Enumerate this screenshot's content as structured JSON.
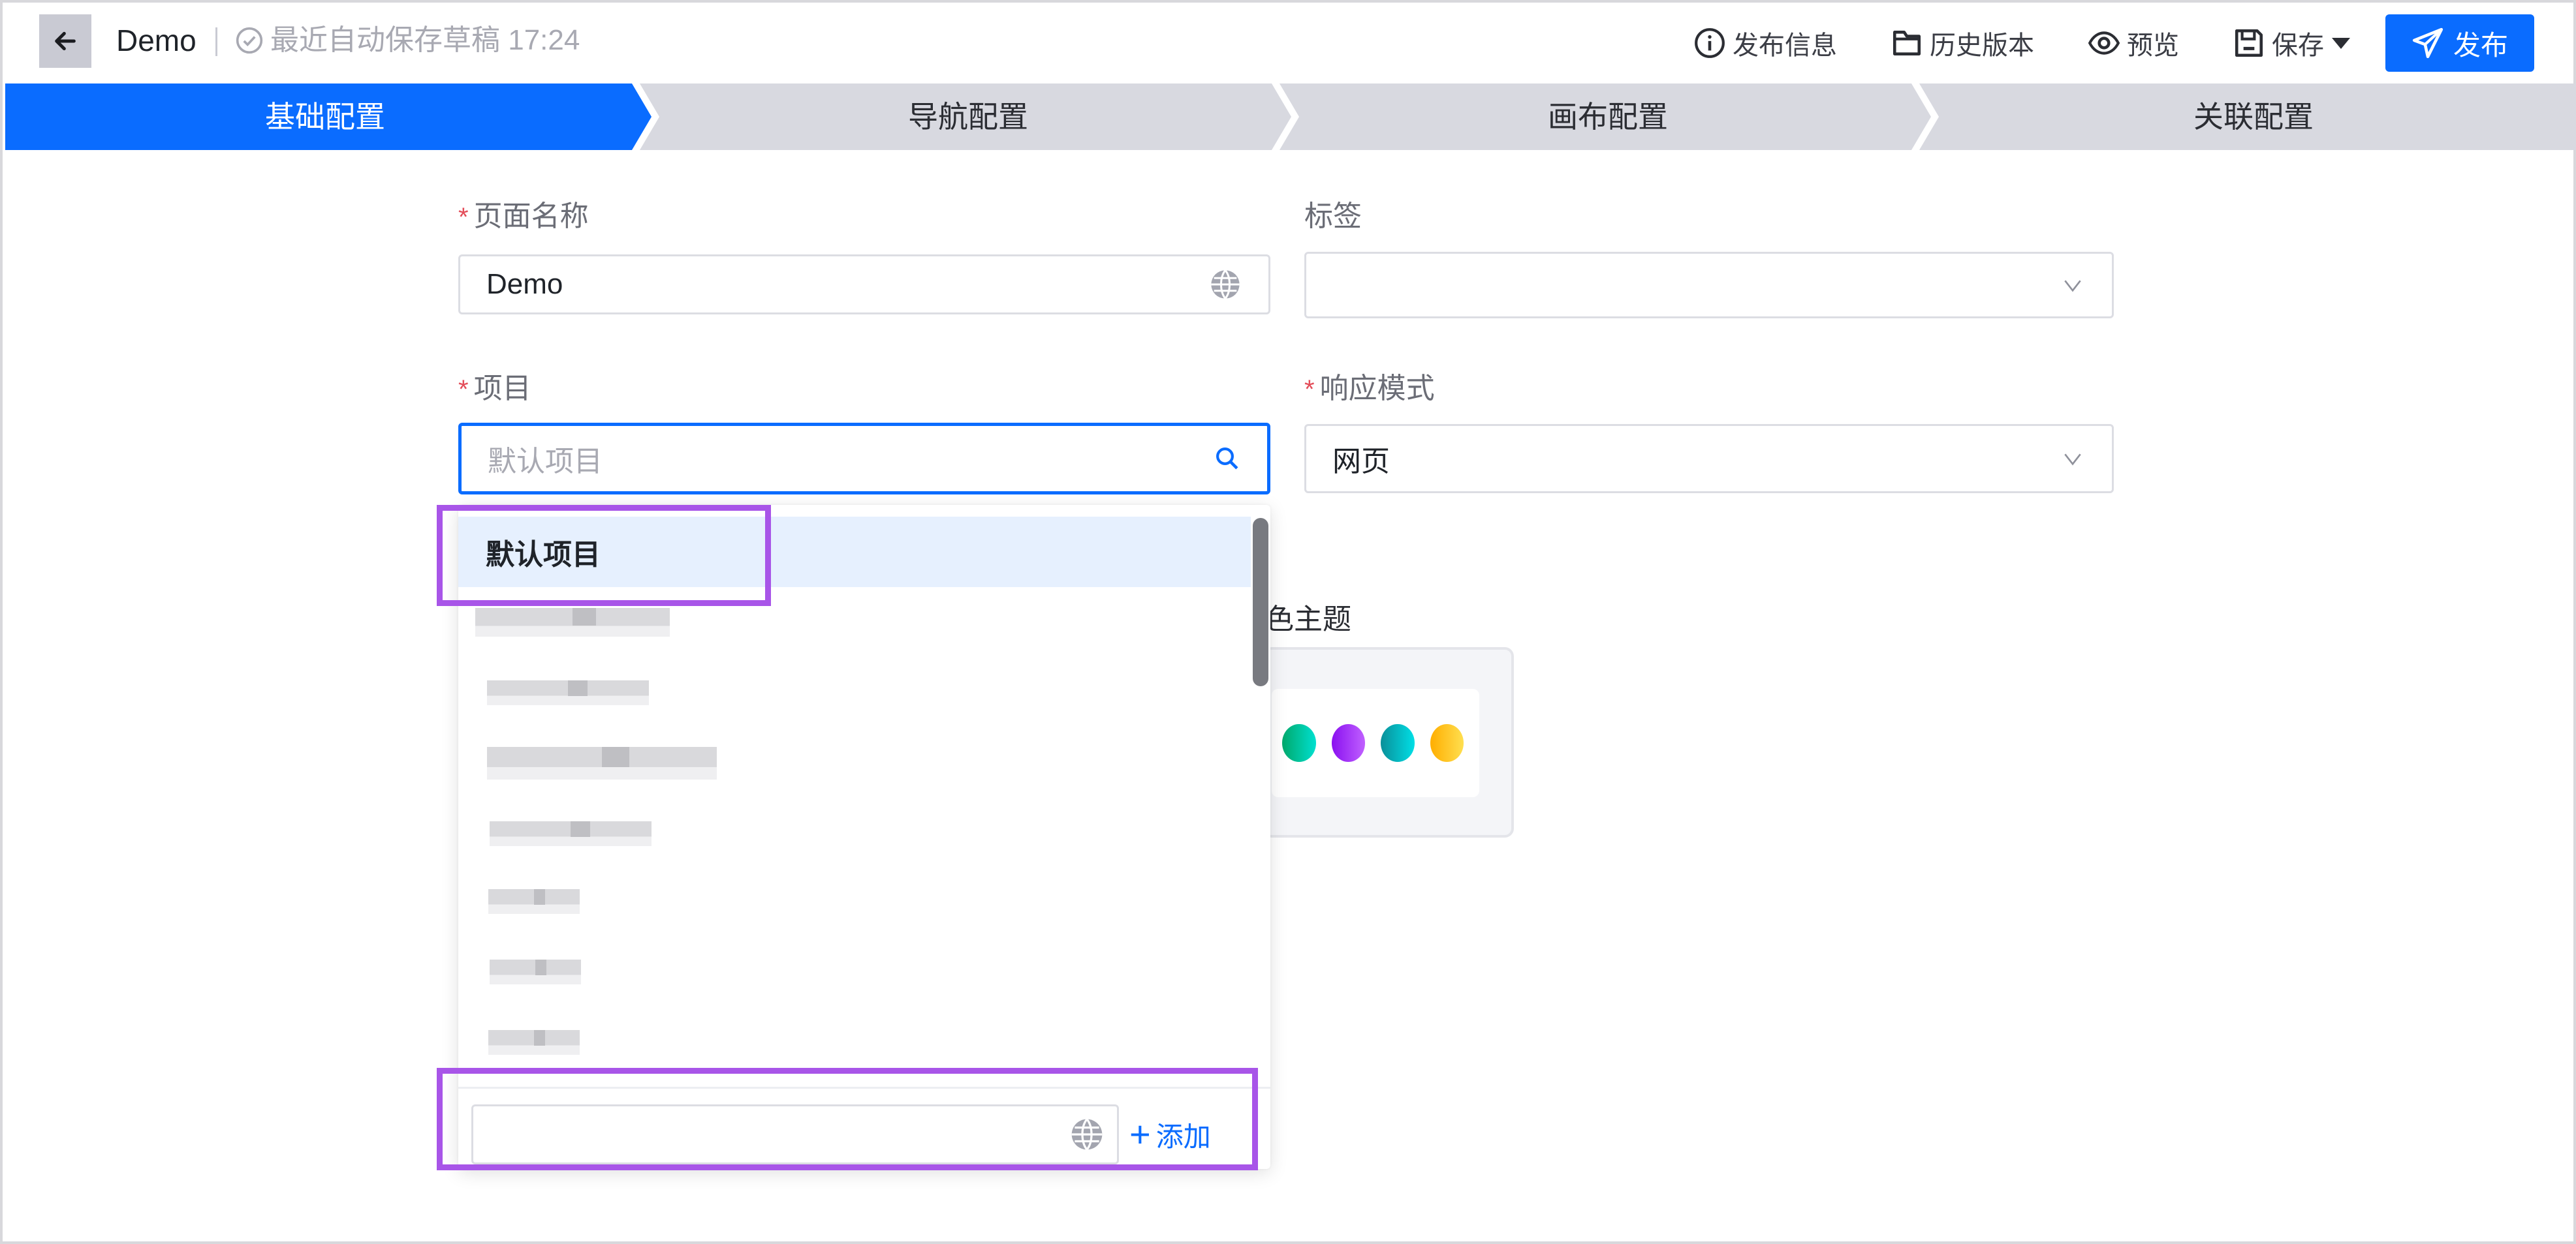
{
  "header": {
    "back_icon": "arrow-left-icon",
    "title": "Demo",
    "autosave_icon": "check-circle-icon",
    "autosave_text": "最近自动保存草稿 17:24",
    "actions": [
      {
        "icon": "info-circle-icon",
        "label": "发布信息"
      },
      {
        "icon": "folder-icon",
        "label": "历史版本"
      },
      {
        "icon": "eye-icon",
        "label": "预览"
      },
      {
        "icon": "save-icon",
        "label": "保存",
        "has_dropdown": true
      }
    ],
    "publish": {
      "icon": "send-icon",
      "label": "发布"
    }
  },
  "steps": [
    {
      "label": "基础配置",
      "active": true
    },
    {
      "label": "导航配置",
      "active": false
    },
    {
      "label": "画布配置",
      "active": false
    },
    {
      "label": "关联配置",
      "active": false
    }
  ],
  "form": {
    "page_name": {
      "label": "页面名称",
      "required": true,
      "value": "Demo",
      "suffix_icon": "globe-icon"
    },
    "tags": {
      "label": "标签",
      "required": false,
      "value": "",
      "suffix_icon": "chevron-down-icon"
    },
    "project": {
      "label": "项目",
      "required": true,
      "placeholder": "默认项目",
      "suffix_icon": "search-icon",
      "focused": true
    },
    "response_mode": {
      "label": "响应模式",
      "required": true,
      "value": "网页",
      "suffix_icon": "chevron-down-icon"
    },
    "color_theme": {
      "label_visible": "色主题",
      "swatches": [
        "#00c39a",
        "#9b2cf5",
        "#0ab5c4",
        "#ffc21f"
      ]
    }
  },
  "project_dropdown": {
    "options": [
      {
        "label": "默认项目",
        "selected": true
      },
      {
        "label": "[redacted]",
        "blurred": true
      },
      {
        "label": "[redacted]",
        "blurred": true
      },
      {
        "label": "[redacted]",
        "blurred": true
      },
      {
        "label": "[redacted]",
        "blurred": true
      },
      {
        "label": "[redacted]",
        "blurred": true
      },
      {
        "label": "[redacted]",
        "blurred": true
      },
      {
        "label": "[redacted]",
        "blurred": true
      }
    ],
    "new_input": {
      "value": "",
      "suffix_icon": "globe-icon"
    },
    "add_label": "添加"
  },
  "colors": {
    "primary": "#0a6cff",
    "step_inactive": "#d8d9e0",
    "required": "#e34d59",
    "annotation": "#a855e8",
    "option_active_bg": "#e6f0fe"
  }
}
